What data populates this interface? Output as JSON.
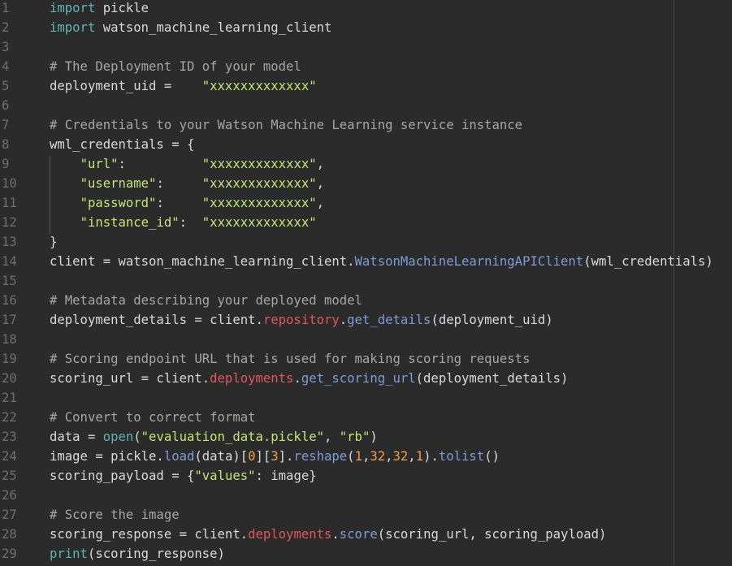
{
  "editor": {
    "language": "python",
    "colors": {
      "background": "#2b2b2b",
      "line_number": "#6e6e6e",
      "keyword": "#5fb3b3",
      "comment": "#a6a6a6",
      "string": "#c5e478",
      "number": "#f0a050",
      "attribute": "#e0575b",
      "method": "#7e9cd8"
    },
    "lines": [
      {
        "n": "1",
        "tokens": [
          [
            "kw",
            "import"
          ],
          [
            "tx",
            " pickle"
          ]
        ]
      },
      {
        "n": "2",
        "tokens": [
          [
            "kw",
            "import"
          ],
          [
            "tx",
            " watson_machine_learning_client"
          ]
        ]
      },
      {
        "n": "3",
        "tokens": []
      },
      {
        "n": "4",
        "tokens": [
          [
            "cm",
            "# The Deployment ID of your model"
          ]
        ]
      },
      {
        "n": "5",
        "tokens": [
          [
            "tx",
            "deployment_uid =    "
          ],
          [
            "st",
            "\"xxxxxxxxxxxxx\""
          ]
        ]
      },
      {
        "n": "6",
        "tokens": []
      },
      {
        "n": "7",
        "tokens": [
          [
            "cm",
            "# Credentials to your Watson Machine Learning service instance"
          ]
        ]
      },
      {
        "n": "8",
        "tokens": [
          [
            "tx",
            "wml_credentials = {"
          ]
        ]
      },
      {
        "n": "9",
        "tokens": [
          [
            "tx",
            "    "
          ],
          [
            "st",
            "\"url\""
          ],
          [
            "tx",
            ":          "
          ],
          [
            "st",
            "\"xxxxxxxxxxxxx\""
          ],
          [
            "tx",
            ","
          ]
        ]
      },
      {
        "n": "10",
        "tokens": [
          [
            "tx",
            "    "
          ],
          [
            "st",
            "\"username\""
          ],
          [
            "tx",
            ":     "
          ],
          [
            "st",
            "\"xxxxxxxxxxxxx\""
          ],
          [
            "tx",
            ","
          ]
        ]
      },
      {
        "n": "11",
        "tokens": [
          [
            "tx",
            "    "
          ],
          [
            "st",
            "\"password\""
          ],
          [
            "tx",
            ":     "
          ],
          [
            "st",
            "\"xxxxxxxxxxxxx\""
          ],
          [
            "tx",
            ","
          ]
        ]
      },
      {
        "n": "12",
        "tokens": [
          [
            "tx",
            "    "
          ],
          [
            "st",
            "\"instance_id\""
          ],
          [
            "tx",
            ":  "
          ],
          [
            "st",
            "\"xxxxxxxxxxxxx\""
          ]
        ]
      },
      {
        "n": "13",
        "tokens": [
          [
            "tx",
            "}"
          ]
        ]
      },
      {
        "n": "14",
        "tokens": [
          [
            "tx",
            "client = watson_machine_learning_client."
          ],
          [
            "fn",
            "WatsonMachineLearningAPIClient"
          ],
          [
            "tx",
            "(wml_credentials)"
          ]
        ]
      },
      {
        "n": "15",
        "tokens": []
      },
      {
        "n": "16",
        "tokens": [
          [
            "cm",
            "# Metadata describing your deployed model"
          ]
        ]
      },
      {
        "n": "17",
        "tokens": [
          [
            "tx",
            "deployment_details = client."
          ],
          [
            "attr",
            "repository"
          ],
          [
            "tx",
            "."
          ],
          [
            "fn",
            "get_details"
          ],
          [
            "tx",
            "(deployment_uid)"
          ]
        ]
      },
      {
        "n": "18",
        "tokens": []
      },
      {
        "n": "19",
        "tokens": [
          [
            "cm",
            "# Scoring endpoint URL that is used for making scoring requests"
          ]
        ]
      },
      {
        "n": "20",
        "tokens": [
          [
            "tx",
            "scoring_url = client."
          ],
          [
            "attr",
            "deployments"
          ],
          [
            "tx",
            "."
          ],
          [
            "fn",
            "get_scoring_url"
          ],
          [
            "tx",
            "(deployment_details)"
          ]
        ]
      },
      {
        "n": "21",
        "tokens": []
      },
      {
        "n": "22",
        "tokens": [
          [
            "cm",
            "# Convert to correct format"
          ]
        ]
      },
      {
        "n": "23",
        "tokens": [
          [
            "tx",
            "data = "
          ],
          [
            "kw",
            "open"
          ],
          [
            "tx",
            "("
          ],
          [
            "st",
            "\"evaluation_data.pickle\""
          ],
          [
            "tx",
            ", "
          ],
          [
            "st",
            "\"rb\""
          ],
          [
            "tx",
            ")"
          ]
        ]
      },
      {
        "n": "24",
        "tokens": [
          [
            "tx",
            "image = pickle."
          ],
          [
            "fn",
            "load"
          ],
          [
            "tx",
            "(data)["
          ],
          [
            "num",
            "0"
          ],
          [
            "tx",
            "]["
          ],
          [
            "num",
            "3"
          ],
          [
            "tx",
            "]."
          ],
          [
            "fn",
            "reshape"
          ],
          [
            "tx",
            "("
          ],
          [
            "num",
            "1"
          ],
          [
            "tx",
            ","
          ],
          [
            "num",
            "32"
          ],
          [
            "tx",
            ","
          ],
          [
            "num",
            "32"
          ],
          [
            "tx",
            ","
          ],
          [
            "num",
            "1"
          ],
          [
            "tx",
            ")."
          ],
          [
            "fn",
            "tolist"
          ],
          [
            "tx",
            "()"
          ]
        ]
      },
      {
        "n": "25",
        "tokens": [
          [
            "tx",
            "scoring_payload = {"
          ],
          [
            "st",
            "\"values\""
          ],
          [
            "tx",
            ": image}"
          ]
        ]
      },
      {
        "n": "26",
        "tokens": []
      },
      {
        "n": "27",
        "tokens": [
          [
            "cm",
            "# Score the image"
          ]
        ]
      },
      {
        "n": "28",
        "tokens": [
          [
            "tx",
            "scoring_response = client."
          ],
          [
            "attr",
            "deployments"
          ],
          [
            "tx",
            "."
          ],
          [
            "fn",
            "score"
          ],
          [
            "tx",
            "(scoring_url, scoring_payload)"
          ]
        ]
      },
      {
        "n": "29",
        "tokens": [
          [
            "kw",
            "print"
          ],
          [
            "tx",
            "(scoring_response)"
          ]
        ]
      }
    ]
  }
}
